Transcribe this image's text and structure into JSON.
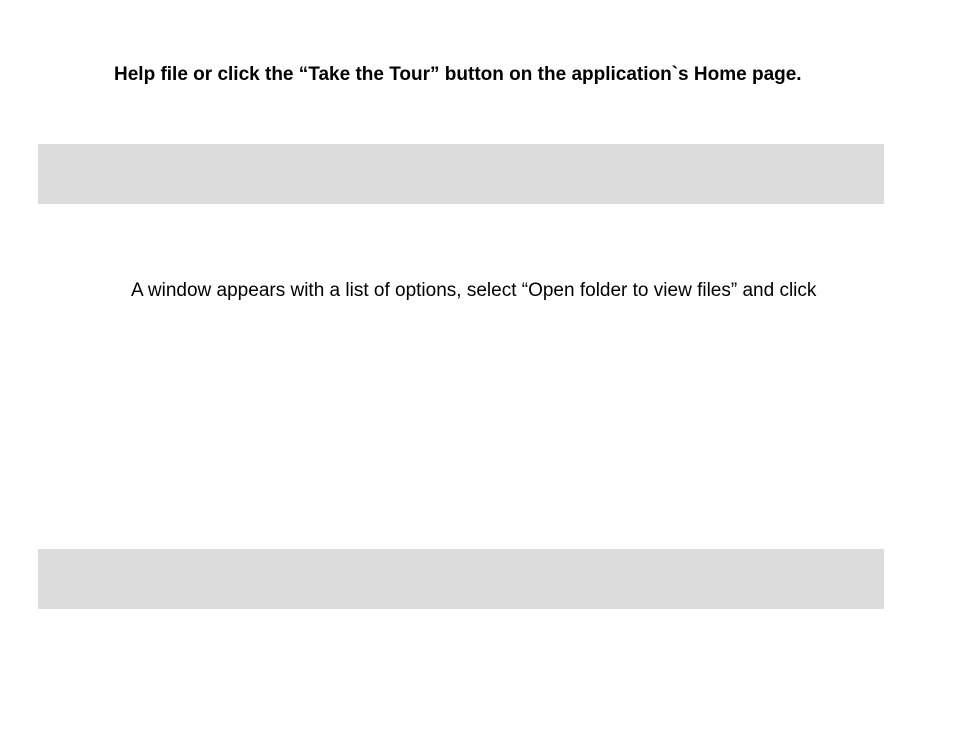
{
  "heading": "Help file or click the “Take the Tour” button on the application`s Home page.",
  "paragraph": "A window appears with a list of options, select “Open folder to view files” and click"
}
